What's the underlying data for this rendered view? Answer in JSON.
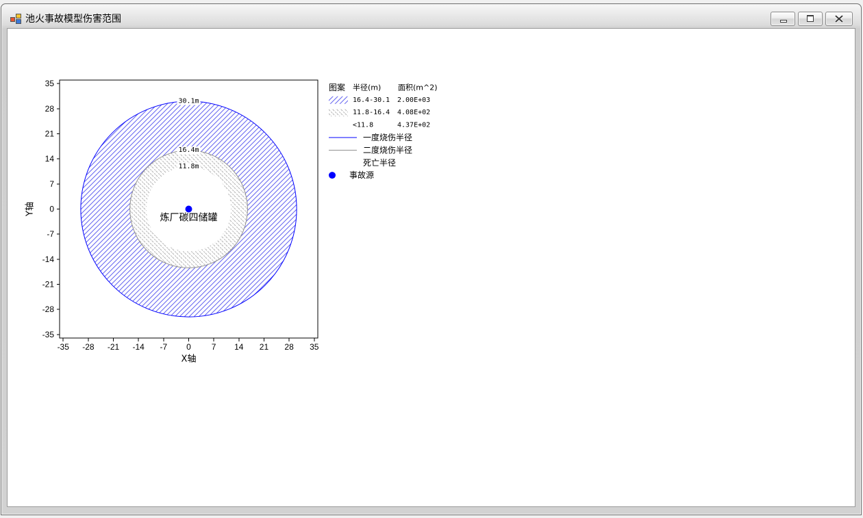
{
  "window": {
    "title": "池火事故模型伤害范围",
    "icon": "app-icon",
    "controls": {
      "minimize_icon": "minimize-icon",
      "maximize_icon": "maximize-icon",
      "close_icon": "close-icon"
    }
  },
  "chart_data": {
    "type": "scatter",
    "xlabel": "X轴",
    "ylabel": "Y轴",
    "xlim": [
      -36,
      36
    ],
    "ylim": [
      -36,
      36
    ],
    "xticks": [
      -35,
      -28,
      -21,
      -14,
      -7,
      0,
      7,
      14,
      21,
      28,
      35
    ],
    "yticks": [
      35,
      28,
      21,
      14,
      7,
      0,
      -7,
      -14,
      -21,
      -28,
      -35
    ],
    "grid": false,
    "points": [
      {
        "x": 0,
        "y": 0,
        "label": "炼厂碳四储罐",
        "color": "#0000ff"
      }
    ],
    "circles": [
      {
        "radius": 30.1,
        "label": "30.1m",
        "stroke": "#0000ff"
      },
      {
        "radius": 16.4,
        "label": "16.4m",
        "stroke": "#909090"
      },
      {
        "radius": 11.8,
        "label": "11.8m",
        "stroke": null
      }
    ],
    "legend": {
      "position": "right",
      "headers": [
        "图案",
        "半径(m)",
        "面积(m^2)"
      ],
      "zones": [
        {
          "range": "16.4-30.1",
          "area": "2.00E+03",
          "color": "#6464f0"
        },
        {
          "range": "11.8-16.4",
          "area": "4.08E+02",
          "color": "#b4b4b4"
        },
        {
          "range": "<11.8",
          "area": "4.37E+02",
          "color": null
        }
      ],
      "lines": [
        {
          "label": "一度烧伤半径",
          "color": "#0000ff"
        },
        {
          "label": "二度烧伤半径",
          "color": "#909090"
        },
        {
          "label": "死亡半径",
          "color": null
        }
      ],
      "marker": {
        "label": "事故源",
        "color": "#0000ff"
      }
    }
  }
}
